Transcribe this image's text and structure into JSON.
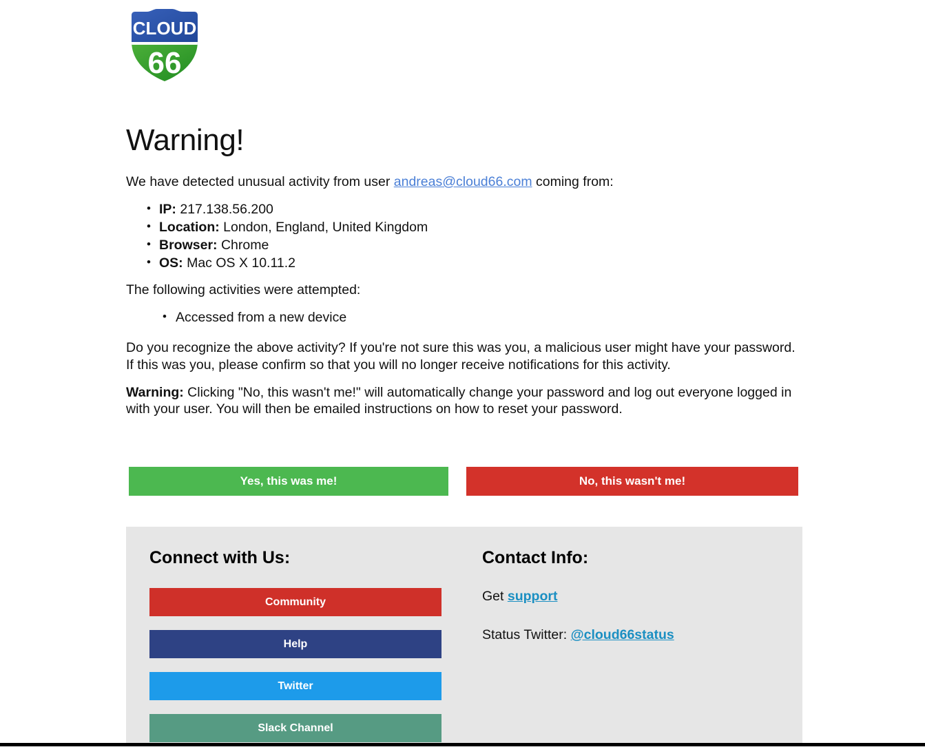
{
  "logo": {
    "top_text": "CLOUD",
    "bottom_text": "66",
    "blue": "#2a55a8",
    "green": "#3a9e2e"
  },
  "main": {
    "title": "Warning!",
    "intro_prefix": "We have detected unusual activity from user ",
    "intro_link": "andreas@cloud66.com",
    "intro_suffix": " coming from:",
    "info_list": [
      {
        "label": "IP:",
        "value": "217.138.56.200"
      },
      {
        "label": "Location:",
        "value": "London, England, United Kingdom"
      },
      {
        "label": "Browser:",
        "value": "Chrome"
      },
      {
        "label": "OS:",
        "value": "Mac OS X 10.11.2"
      }
    ],
    "activities_heading": "The following activities were attempted:",
    "activities": [
      "Accessed from a new device"
    ],
    "recognize_paragraph": "Do you recognize the above activity? If you're not sure this was you, a malicious user might have your password. If this was you, please confirm so that you will no longer receive notifications for this activity.",
    "warning_label": "Warning:",
    "warning_paragraph": " Clicking \"No, this wasn't me!\" will automatically change your password and log out everyone logged in with your user. You will then be emailed instructions on how to reset your password."
  },
  "actions": {
    "yes_label": "Yes, this was me!",
    "yes_color": "#4cb850",
    "no_label": "No, this wasn't me!",
    "no_color": "#d3322a"
  },
  "footer": {
    "background": "#e6e6e6",
    "connect": {
      "title": "Connect with Us:",
      "buttons": [
        {
          "label": "Community",
          "color": "#cf3029"
        },
        {
          "label": "Help",
          "color": "#2e4284"
        },
        {
          "label": "Twitter",
          "color": "#1d9bea"
        },
        {
          "label": "Slack Channel",
          "color": "#569b83"
        }
      ]
    },
    "contact": {
      "title": "Contact Info:",
      "support_prefix": "Get ",
      "support_link": "support",
      "twitter_prefix": "Status Twitter: ",
      "twitter_link": "@cloud66status",
      "link_color": "#1b8fc2"
    }
  }
}
